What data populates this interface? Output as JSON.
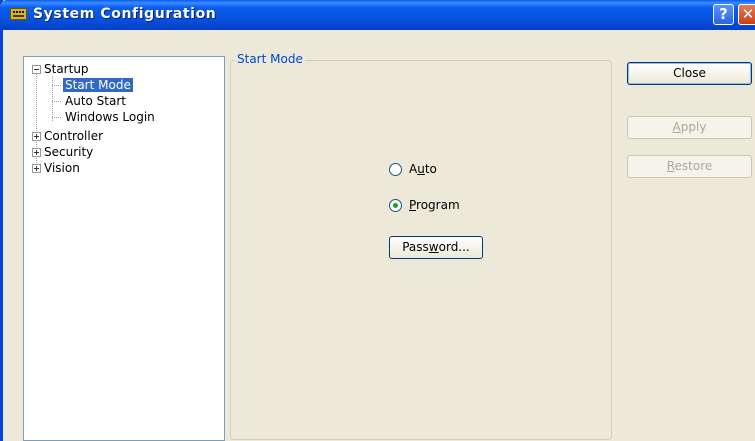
{
  "window": {
    "title": "System Configuration",
    "help_glyph": "?",
    "close_glyph": "✕"
  },
  "tree": {
    "startup": "Startup",
    "start_mode": "Start Mode",
    "auto_start": "Auto Start",
    "windows_login": "Windows Login",
    "controller": "Controller",
    "security": "Security",
    "vision": "Vision"
  },
  "start_mode_group": {
    "label": "Start Mode",
    "auto": {
      "pre": "A",
      "accel": "u",
      "post": "to",
      "checked": false
    },
    "program": {
      "pre": "",
      "accel": "P",
      "post": "rogram",
      "checked": true
    },
    "password_button": {
      "pre": "Pass",
      "accel": "w",
      "post": "ord..."
    }
  },
  "buttons": {
    "close": "Close",
    "apply": {
      "pre": "",
      "accel": "A",
      "post": "pply",
      "enabled": false
    },
    "restore": {
      "pre": "",
      "accel": "R",
      "post": "estore",
      "enabled": false
    }
  },
  "colors": {
    "titlebar": "#0a5df0",
    "selection": "#316ac5",
    "group_label": "#0046d5",
    "face": "#ece9d8"
  }
}
